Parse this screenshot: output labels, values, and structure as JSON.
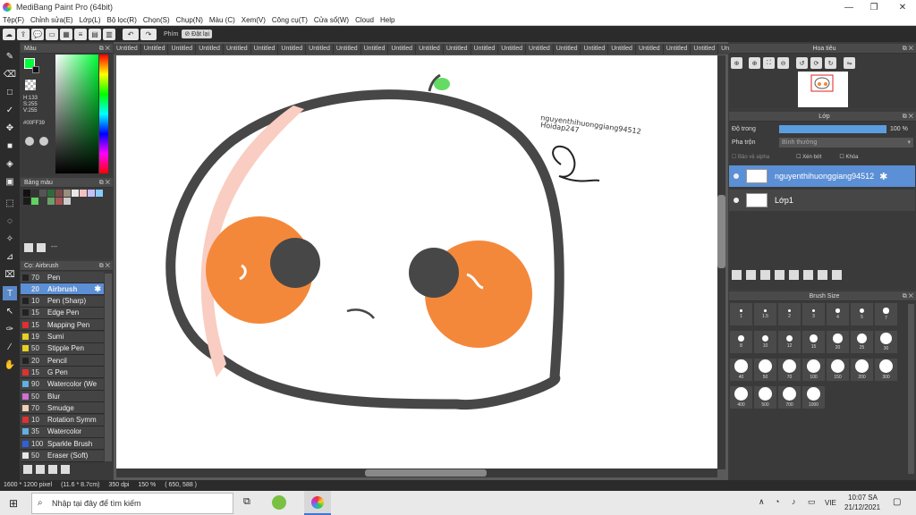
{
  "window": {
    "title": "MediBang Paint Pro (64bit)"
  },
  "menu": [
    "Tệp(F)",
    "Chỉnh sửa(E)",
    "Lớp(L)",
    "Bộ lọc(R)",
    "Chọn(S)",
    "Chụp(N)",
    "Màu (C)",
    "Xem(V)",
    "Công cụ(T)",
    "Cửa sổ(W)",
    "Cloud",
    "Help"
  ],
  "toolbar": {
    "phim_label": "Phím",
    "reset_label": "Đặt lại"
  },
  "color_panel": {
    "title": "Màu",
    "h": "H:133",
    "s": "S:255",
    "v": "V:255",
    "hex": "#00FF39",
    "fg": "#00ff39"
  },
  "palette_panel": {
    "title": "Bảng màu",
    "dots": "---"
  },
  "palette_colors": [
    "#111111",
    "#333333",
    "#555555",
    "#2f6b3a",
    "#7a4b4b",
    "#9a8f7a",
    "#e8e8e8",
    "#f2c1c1",
    "#c0c0ff",
    "#88ccff",
    "#1a1a1a",
    "#5fd35f",
    "#3a3a3a",
    "#6aa06a",
    "#aa5555",
    "#cccccc"
  ],
  "brush_panel": {
    "title": "Cọ: Airbrush",
    "items": [
      {
        "size": "70",
        "name": "Pen",
        "color": "#222222"
      },
      {
        "size": "20",
        "name": "Airbrush",
        "color": "#5b8fd6",
        "selected": true
      },
      {
        "size": "10",
        "name": "Pen (Sharp)",
        "color": "#222222"
      },
      {
        "size": "15",
        "name": "Edge Pen",
        "color": "#222222"
      },
      {
        "size": "15",
        "name": "Mapping Pen",
        "color": "#e03030"
      },
      {
        "size": "19",
        "name": "Sumi",
        "color": "#e8d020"
      },
      {
        "size": "50",
        "name": "Stipple Pen",
        "color": "#e8d020"
      },
      {
        "size": "20",
        "name": "Pencil",
        "color": "#222222"
      },
      {
        "size": "15",
        "name": "G Pen",
        "color": "#e03030"
      },
      {
        "size": "90",
        "name": "Watercolor (We",
        "color": "#60b0e0"
      },
      {
        "size": "50",
        "name": "Blur",
        "color": "#d070d0"
      },
      {
        "size": "70",
        "name": "Smudge",
        "color": "#f0d0b0"
      },
      {
        "size": "10",
        "name": "Rotation Symm",
        "color": "#e03030"
      },
      {
        "size": "35",
        "name": "Watercolor",
        "color": "#60b0e0"
      },
      {
        "size": "100",
        "name": "Sparkle Brush",
        "color": "#3060e0"
      },
      {
        "size": "50",
        "name": "Eraser (Soft)",
        "color": "#e8e8e8"
      }
    ]
  },
  "tabs": [
    "Untitled",
    "Untitled",
    "Untitled",
    "Untitled",
    "Untitled",
    "Untitled",
    "Untitled",
    "Untitled",
    "Untitled",
    "Untitled",
    "Untitled",
    "Untitled",
    "Untitled",
    "Untitled",
    "Untitled",
    "Untitled",
    "Untitled",
    "Untitled",
    "Untitled",
    "Untitled",
    "Untitled",
    "Untitled",
    "Untitled"
  ],
  "canvas": {
    "signature_line1": "nguyenthihuonggiang94512",
    "signature_line2": "Hoidap247"
  },
  "navigator": {
    "title": "Hoa tiêu"
  },
  "layer_panel": {
    "title": "Lớp",
    "opacity_label": "Độ trong",
    "opacity_value": "100 %",
    "blend_label": "Pha trộn",
    "blend_value": "Bình thường",
    "protect_alpha": "Bảo vệ alpha",
    "clip": "Xén bớt",
    "lock": "Khóa",
    "layers": [
      {
        "name": "nguyenthihuonggiang94512",
        "selected": true
      },
      {
        "name": "Lớp1",
        "selected": false
      }
    ]
  },
  "brush_size_panel": {
    "title": "Brush Size",
    "sizes": [
      "1",
      "1.5",
      "2",
      "3",
      "4",
      "5",
      "7",
      "8",
      "10",
      "12",
      "15",
      "20",
      "25",
      "30",
      "40",
      "50",
      "70",
      "100",
      "150",
      "200",
      "300",
      "400",
      "500",
      "700",
      "1000"
    ]
  },
  "status": {
    "dimensions": "1600 * 1200 pixel",
    "physical": "(11.6 * 8.7cm)",
    "dpi": "350 dpi",
    "zoom": "150 %",
    "coords": "( 650, 588 )"
  },
  "taskbar": {
    "search_placeholder": "Nhập tại đây để tìm kiếm",
    "lang": "VIE",
    "time": "10:07 SA",
    "date": "21/12/2021"
  }
}
